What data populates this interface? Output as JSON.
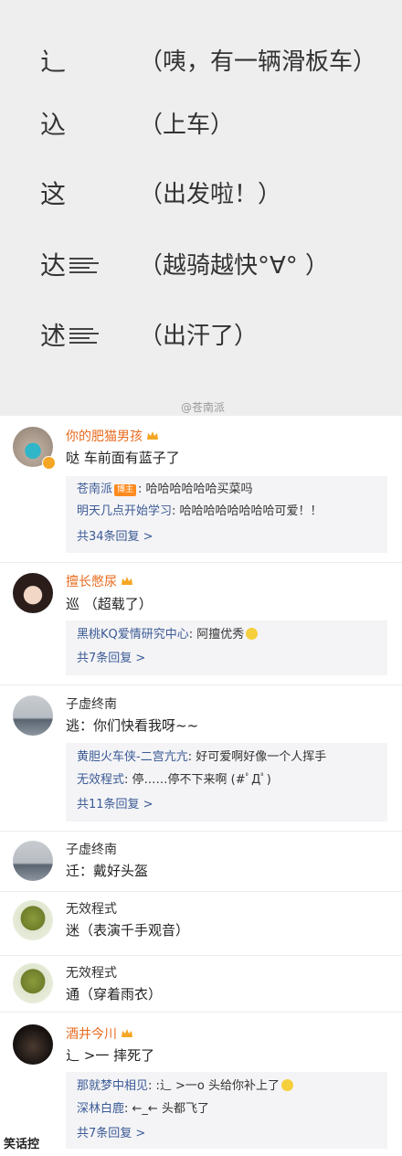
{
  "top": {
    "rows": [
      {
        "char": "辶",
        "desc": "（咦，有一辆滑板车）",
        "speed": false
      },
      {
        "char": "込",
        "desc": "（上车）",
        "speed": false
      },
      {
        "char": "这",
        "desc": "（出发啦！）",
        "speed": false
      },
      {
        "char": "达",
        "desc": "（越骑越快°∀° ）",
        "speed": true
      },
      {
        "char": "述",
        "desc": "（出汗了）",
        "speed": true
      }
    ],
    "watermark": "@苍南派"
  },
  "comments": [
    {
      "user": "你的肥猫男孩",
      "text": "哒 车前面有蓝子了",
      "replies": [
        {
          "name": "苍南派",
          "badge": "博主",
          "text": ": 哈哈哈哈哈哈买菜吗"
        },
        {
          "name": "明天几点开始学习",
          "text": ": 哈哈哈哈哈哈哈哈可爱！！"
        }
      ],
      "more": "共34条回复 >"
    },
    {
      "user": "擅长憋尿",
      "text": "巡 （超载了）",
      "replies": [
        {
          "name": "黑桃KQ爱情研究中心",
          "text": ": 阿擅优秀"
        }
      ],
      "more": "共7条回复 >"
    },
    {
      "user": "子虚终南",
      "text": "逃：你们快看我呀~~",
      "replies": [
        {
          "name": "黄胆火车侠-二宫亢亢",
          "text": ": 好可爱啊好像一个人挥手"
        },
        {
          "name": "无效程式",
          "text": ": 停……停不下来啊 (#ﾟДﾟ)"
        }
      ],
      "more": "共11条回复 >"
    },
    {
      "user": "子虚终南",
      "text": "迁：戴好头盔"
    },
    {
      "user": "无效程式",
      "text": "迷（表演千手观音）"
    },
    {
      "user": "无效程式",
      "text": "通（穿着雨衣）"
    },
    {
      "user": "酒井今川",
      "text": "辶 >一 摔死了",
      "replies": [
        {
          "name": "那就梦中相见",
          "text": ": :辶 >一o 头给你补上了"
        },
        {
          "name": "深林白鹿",
          "text": ": ←_← 头都飞了"
        }
      ],
      "more": "共7条回复 >"
    }
  ],
  "footer_watermark": "笑话控",
  "colors": {
    "vip_name": "#e86b1f",
    "link": "#3b5a95",
    "reply_bg": "#f4f4f6"
  }
}
